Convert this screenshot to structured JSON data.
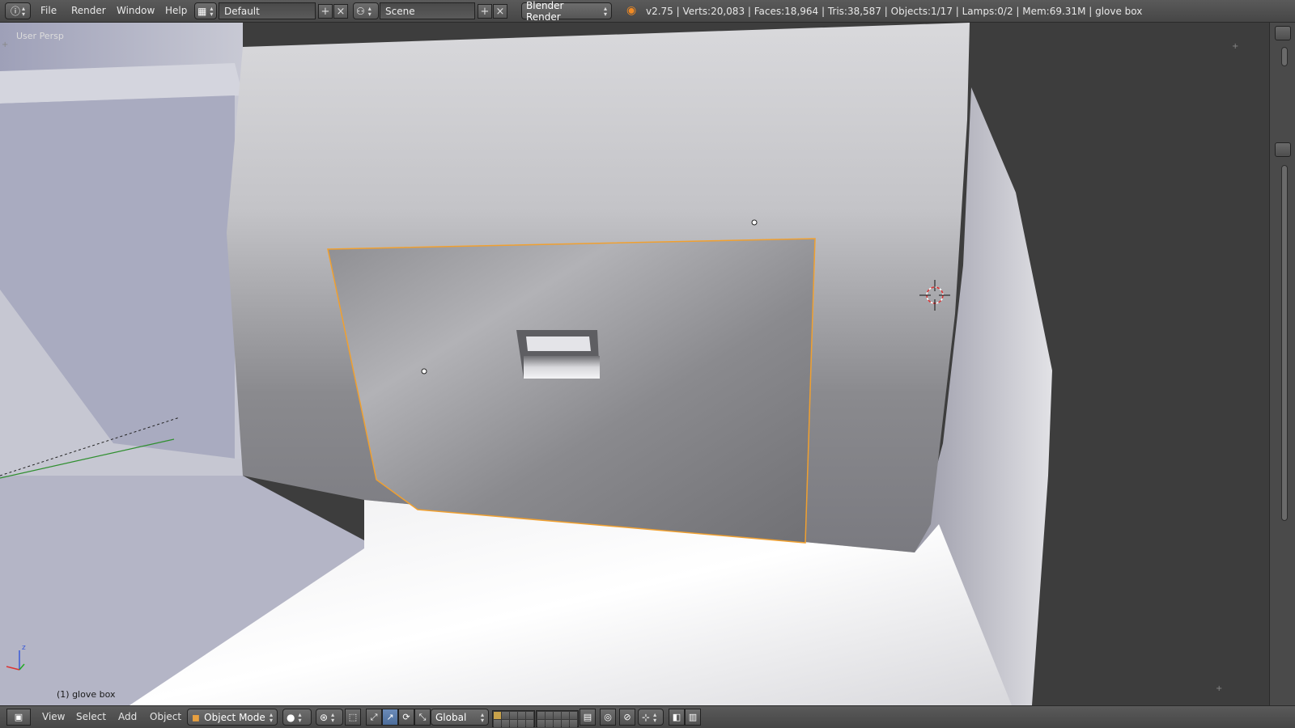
{
  "top_header": {
    "menus": [
      "File",
      "Render",
      "Window",
      "Help"
    ],
    "screen_layout": "Default",
    "scene": "Scene",
    "render_engine": "Blender Render",
    "stats": "v2.75 | Verts:20,083 | Faces:18,964 | Tris:38,587 | Objects:1/17 | Lamps:0/2 | Mem:69.31M | glove box"
  },
  "viewport": {
    "view_label": "User Persp",
    "object_label": "(1) glove box",
    "axis_z": "z"
  },
  "bottom_header": {
    "menus": [
      "View",
      "Select",
      "Add",
      "Object"
    ],
    "mode": "Object Mode",
    "orientation": "Global"
  },
  "colors": {
    "selection_outline": "#f0a030",
    "header_bg": "#4f4f4f",
    "viewport_bg": "#3d3d3d",
    "active_button": "#5680c2"
  },
  "icons": [
    "info-icon",
    "layout-icon",
    "scene-icon",
    "blender-logo-icon",
    "cube-icon",
    "sphere-icon",
    "pivot-icon",
    "manipulator-icon",
    "camera-icon",
    "render-icon",
    "3d-cursor-icon"
  ]
}
